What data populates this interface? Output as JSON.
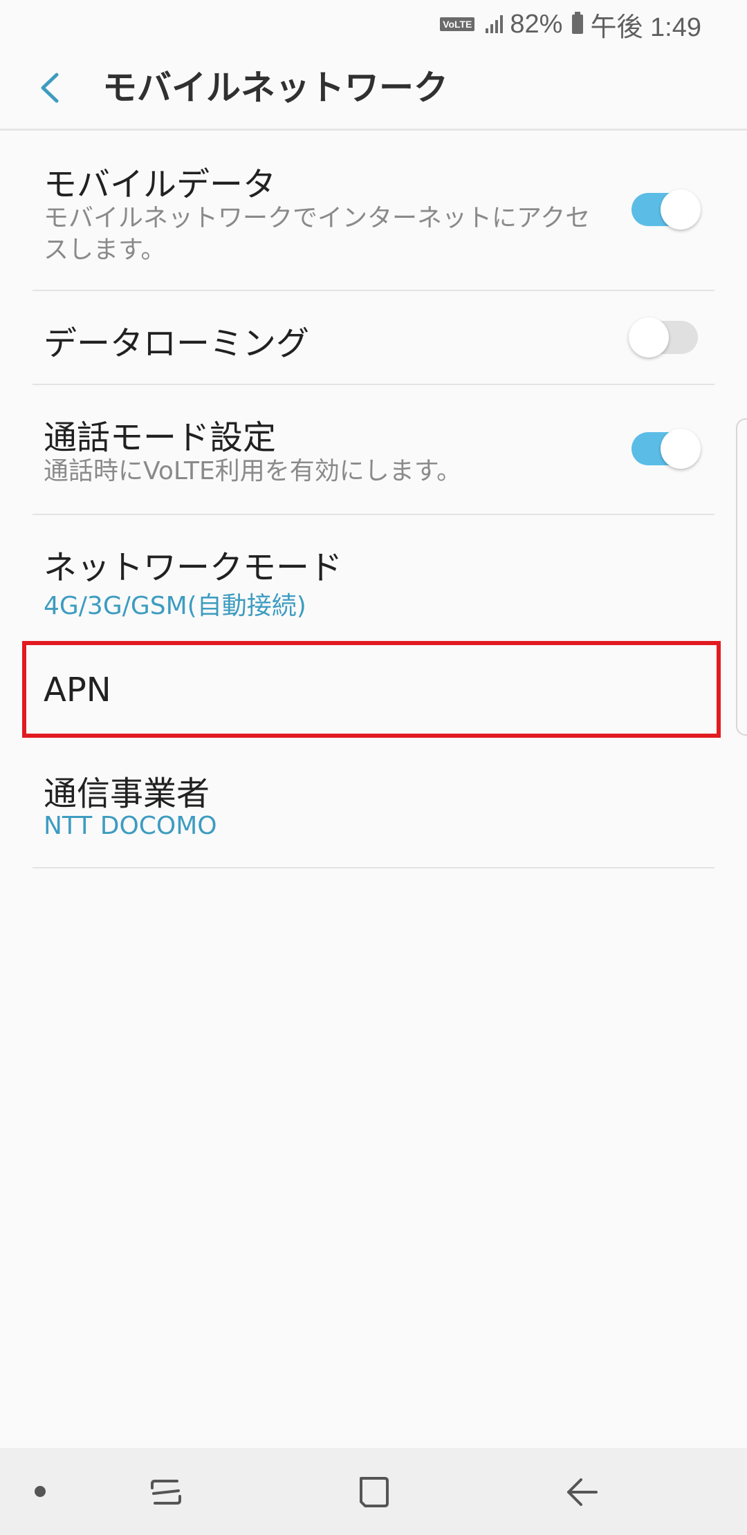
{
  "status_bar": {
    "volte": "VoLTE",
    "battery_percent": "82%",
    "time": "午後 1:49"
  },
  "app_bar": {
    "title": "モバイルネットワーク"
  },
  "settings": {
    "mobile_data": {
      "title": "モバイルデータ",
      "subtitle": "モバイルネットワークでインターネットにアクセスします。",
      "enabled": true
    },
    "data_roaming": {
      "title": "データローミング",
      "enabled": false
    },
    "call_mode": {
      "title": "通話モード設定",
      "subtitle": "通話時にVoLTE利用を有効にします。",
      "enabled": true
    },
    "network_mode": {
      "title": "ネットワークモード",
      "value": "4G/3G/GSM(自動接続)"
    },
    "apn": {
      "title": "APN"
    },
    "carrier": {
      "title": "通信事業者",
      "value": "NTT DOCOMO"
    }
  },
  "colors": {
    "accent": "#5bbde6",
    "value_text": "#3d9cc0",
    "highlight": "#e11b22"
  }
}
